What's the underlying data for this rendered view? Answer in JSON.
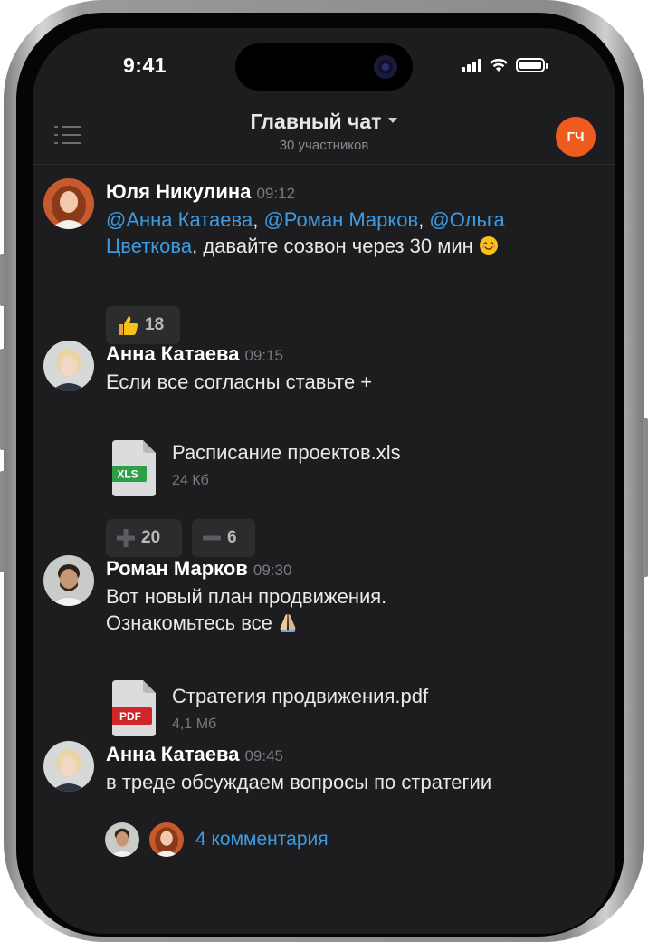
{
  "status_bar": {
    "time": "9:41"
  },
  "header": {
    "title": "Главный чат",
    "subtitle": "30 участников",
    "avatar_initials": "ГЧ",
    "avatar_color": "#ee5b1f"
  },
  "messages": [
    {
      "author": "Юля Никулина",
      "time": "09:12",
      "mentions": [
        "@Анна Катаева",
        "@Роман Марков",
        "@Ольга Цветкова"
      ],
      "sep1": ", ",
      "sep2": ", ",
      "text_rest": ", давайте созвон через 30 мин",
      "emoji": "smiling-face",
      "reactions": [
        {
          "icon": "thumbs-up-icon",
          "count": "18"
        }
      ]
    },
    {
      "author": "Анна Катаева",
      "time": "09:15",
      "text": "Если все согласны ставьте +",
      "attachment": {
        "name": "Расписание проектов.xls",
        "size": "24 Кб",
        "type": "XLS",
        "color": "#2f9e44"
      },
      "reactions": [
        {
          "icon": "plus-icon",
          "count": "20"
        },
        {
          "icon": "minus-icon",
          "count": "6"
        }
      ]
    },
    {
      "author": "Роман Марков",
      "time": "09:30",
      "text_line1": "Вот новый план продвижения.",
      "text_line2": "Ознакомьтесь все",
      "emoji": "folded-hands",
      "attachment": {
        "name": "Стратегия продвижения.pdf",
        "size": "4,1 Мб",
        "type": "PDF",
        "color": "#d0262a"
      }
    },
    {
      "author": "Анна Катаева",
      "time": "09:45",
      "text": "в треде обсуждаем вопросы по стратегии",
      "thread_link": "4 комментария"
    }
  ],
  "colors": {
    "background": "#1d1d1f",
    "link": "#3e9be0",
    "reaction_bg": "#2c2c2e"
  }
}
